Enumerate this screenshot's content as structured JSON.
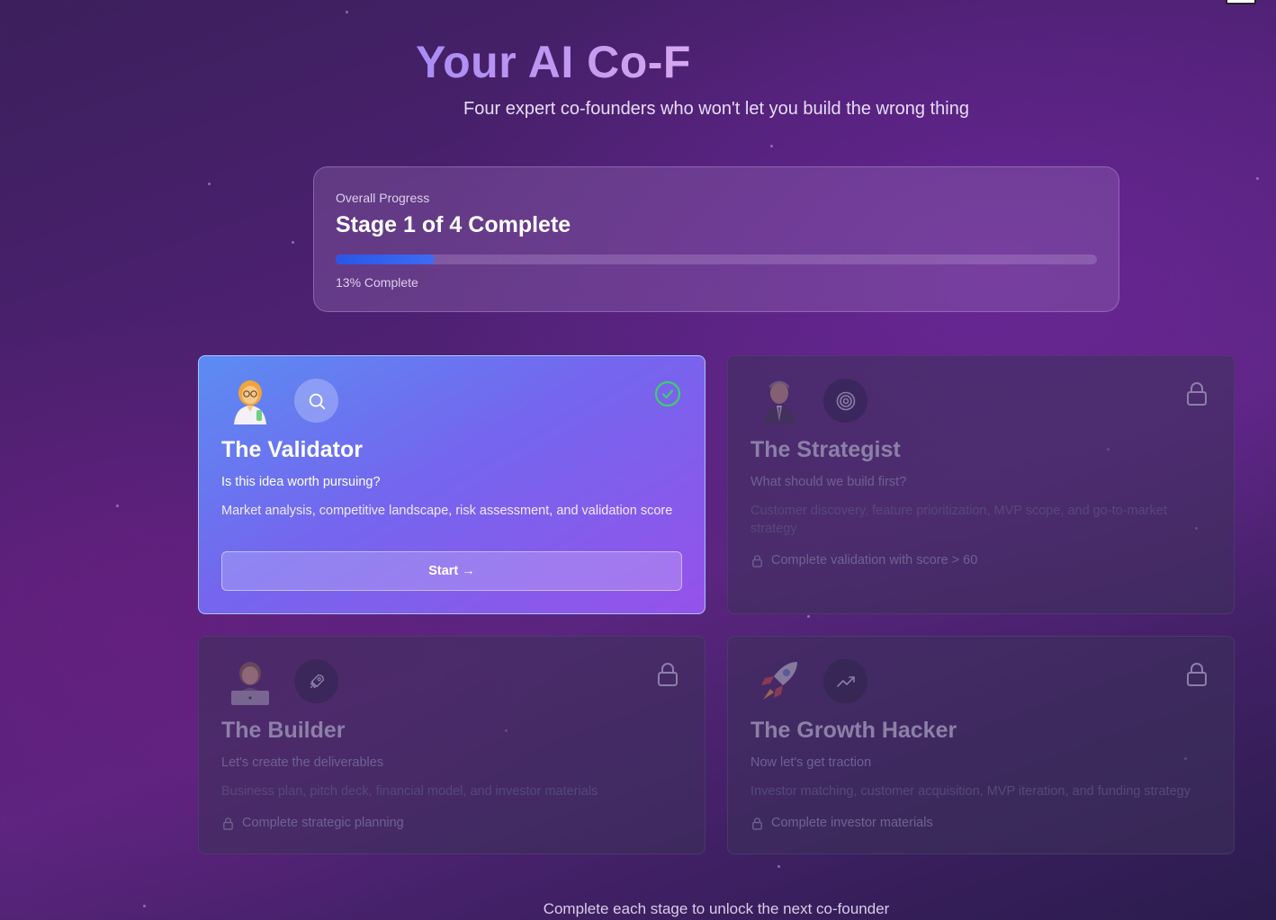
{
  "header": {
    "title": "Your AI Co-F",
    "subtitle": "Four expert co-founders who won't let you build the wrong thing"
  },
  "progress": {
    "label": "Overall Progress",
    "stage": "Stage 1 of 4 Complete",
    "percent_text": "13% Complete",
    "percent": 13,
    "fill_color": "#2a56e6"
  },
  "cards": [
    {
      "title": "The Validator",
      "question": "Is this idea worth pursuing?",
      "description": "Market analysis, competitive landscape, risk assessment, and validation score",
      "button": "Start →",
      "state": "unlocked",
      "avatar": "woman-scientist-icon",
      "badge": "search-icon",
      "status": "check-circle-icon"
    },
    {
      "title": "The Strategist",
      "question": "What should we build first?",
      "description": "Customer discovery, feature prioritization, MVP scope, and go-to-market strategy",
      "requirement": "Complete validation with score > 60",
      "state": "locked",
      "avatar": "businessman-icon",
      "badge": "target-icon",
      "status": "lock-icon"
    },
    {
      "title": "The Builder",
      "question": "Let's create the deliverables",
      "description": "Business plan, pitch deck, financial model, and investor materials",
      "requirement": "Complete strategic planning",
      "state": "locked",
      "avatar": "woman-technologist-icon",
      "badge": "rocket-outline-icon",
      "status": "lock-icon"
    },
    {
      "title": "The Growth Hacker",
      "question": "Now let's get traction",
      "description": "Investor matching, customer acquisition, MVP iteration, and funding strategy",
      "requirement": "Complete investor materials",
      "state": "locked",
      "avatar": "rocket-icon",
      "badge": "trending-up-icon",
      "status": "lock-icon"
    }
  ],
  "footer": "Complete each stage to unlock the next co-founder",
  "colors": {
    "accent": "#7466ee",
    "success": "#3ccf6e"
  }
}
